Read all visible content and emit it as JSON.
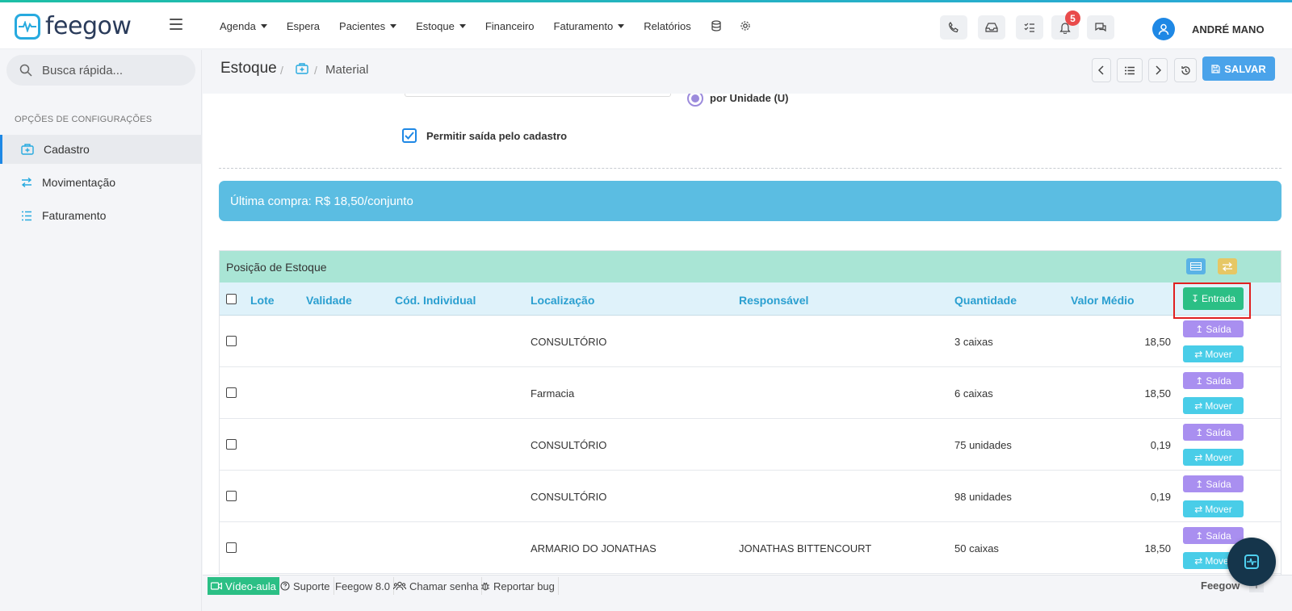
{
  "app": {
    "name": "feegow"
  },
  "nav": {
    "items": [
      {
        "label": "Agenda",
        "caret": true
      },
      {
        "label": "Espera",
        "caret": false
      },
      {
        "label": "Pacientes",
        "caret": true
      },
      {
        "label": "Estoque",
        "caret": true
      },
      {
        "label": "Financeiro",
        "caret": false
      },
      {
        "label": "Faturamento",
        "caret": true
      },
      {
        "label": "Relatórios",
        "caret": false
      }
    ],
    "icons": [
      "database-icon",
      "gear-icon"
    ]
  },
  "toolbar": {
    "icons": [
      "phone-icon",
      "inbox-icon",
      "checklist-icon",
      "bell-icon",
      "chat-icon"
    ],
    "notifications_count": "5",
    "user_name": "ANDRÉ MANO"
  },
  "sidebar": {
    "search_placeholder": "Busca rápida...",
    "heading": "OPÇÕES DE CONFIGURAÇÕES",
    "items": [
      {
        "label": "Cadastro",
        "icon": "medkit-icon",
        "active": true
      },
      {
        "label": "Movimentação",
        "icon": "transfer-icon",
        "active": false
      },
      {
        "label": "Faturamento",
        "icon": "list-icon",
        "active": false
      }
    ]
  },
  "breadcrumb": {
    "title": "Estoque",
    "separator": "/",
    "page": "Material"
  },
  "actions": {
    "save_label": "SALVAR"
  },
  "form": {
    "radio_label": "por Unidade (U)",
    "checkbox_label": "Permitir saída pelo cadastro",
    "checkbox_checked": true
  },
  "alert": {
    "text": "Última compra: R$ 18,50/conjunto"
  },
  "stock": {
    "title": "Posição de Estoque",
    "columns": [
      "Lote",
      "Validade",
      "Cód. Individual",
      "Localização",
      "Responsável",
      "Quantidade",
      "Valor Médio"
    ],
    "entrada_label": "Entrada",
    "saida_label": "Saída",
    "mover_label": "Mover",
    "rows": [
      {
        "lote": "",
        "validade": "",
        "cod": "",
        "localizacao": "CONSULTÓRIO",
        "responsavel": "",
        "quantidade": "3 caixas",
        "valor": "18,50"
      },
      {
        "lote": "",
        "validade": "",
        "cod": "",
        "localizacao": "Farmacia",
        "responsavel": "",
        "quantidade": "6 caixas",
        "valor": "18,50"
      },
      {
        "lote": "",
        "validade": "",
        "cod": "",
        "localizacao": "CONSULTÓRIO",
        "responsavel": "",
        "quantidade": "75 unidades",
        "valor": "0,19"
      },
      {
        "lote": "",
        "validade": "",
        "cod": "",
        "localizacao": "CONSULTÓRIO",
        "responsavel": "",
        "quantidade": "98 unidades",
        "valor": "0,19"
      },
      {
        "lote": "",
        "validade": "",
        "cod": "",
        "localizacao": "ARMARIO DO JONATHAS",
        "responsavel": "JONATHAS BITTENCOURT",
        "quantidade": "50 caixas",
        "valor": "18,50"
      }
    ]
  },
  "footer": {
    "video": "Vídeo-aula",
    "suporte": "Suporte",
    "version": "Feegow 8.0",
    "chamar": "Chamar senha",
    "bug": "Reportar bug",
    "brand": "Feegow"
  },
  "colors": {
    "accent": "#1e88e5",
    "save": "#4aa3ea",
    "alert": "#5bbde2",
    "panel_header": "#a9e5d5",
    "entrada": "#2bbf85",
    "saida": "#a98ff0",
    "mover": "#49cde8",
    "highlight": "#e02020"
  }
}
